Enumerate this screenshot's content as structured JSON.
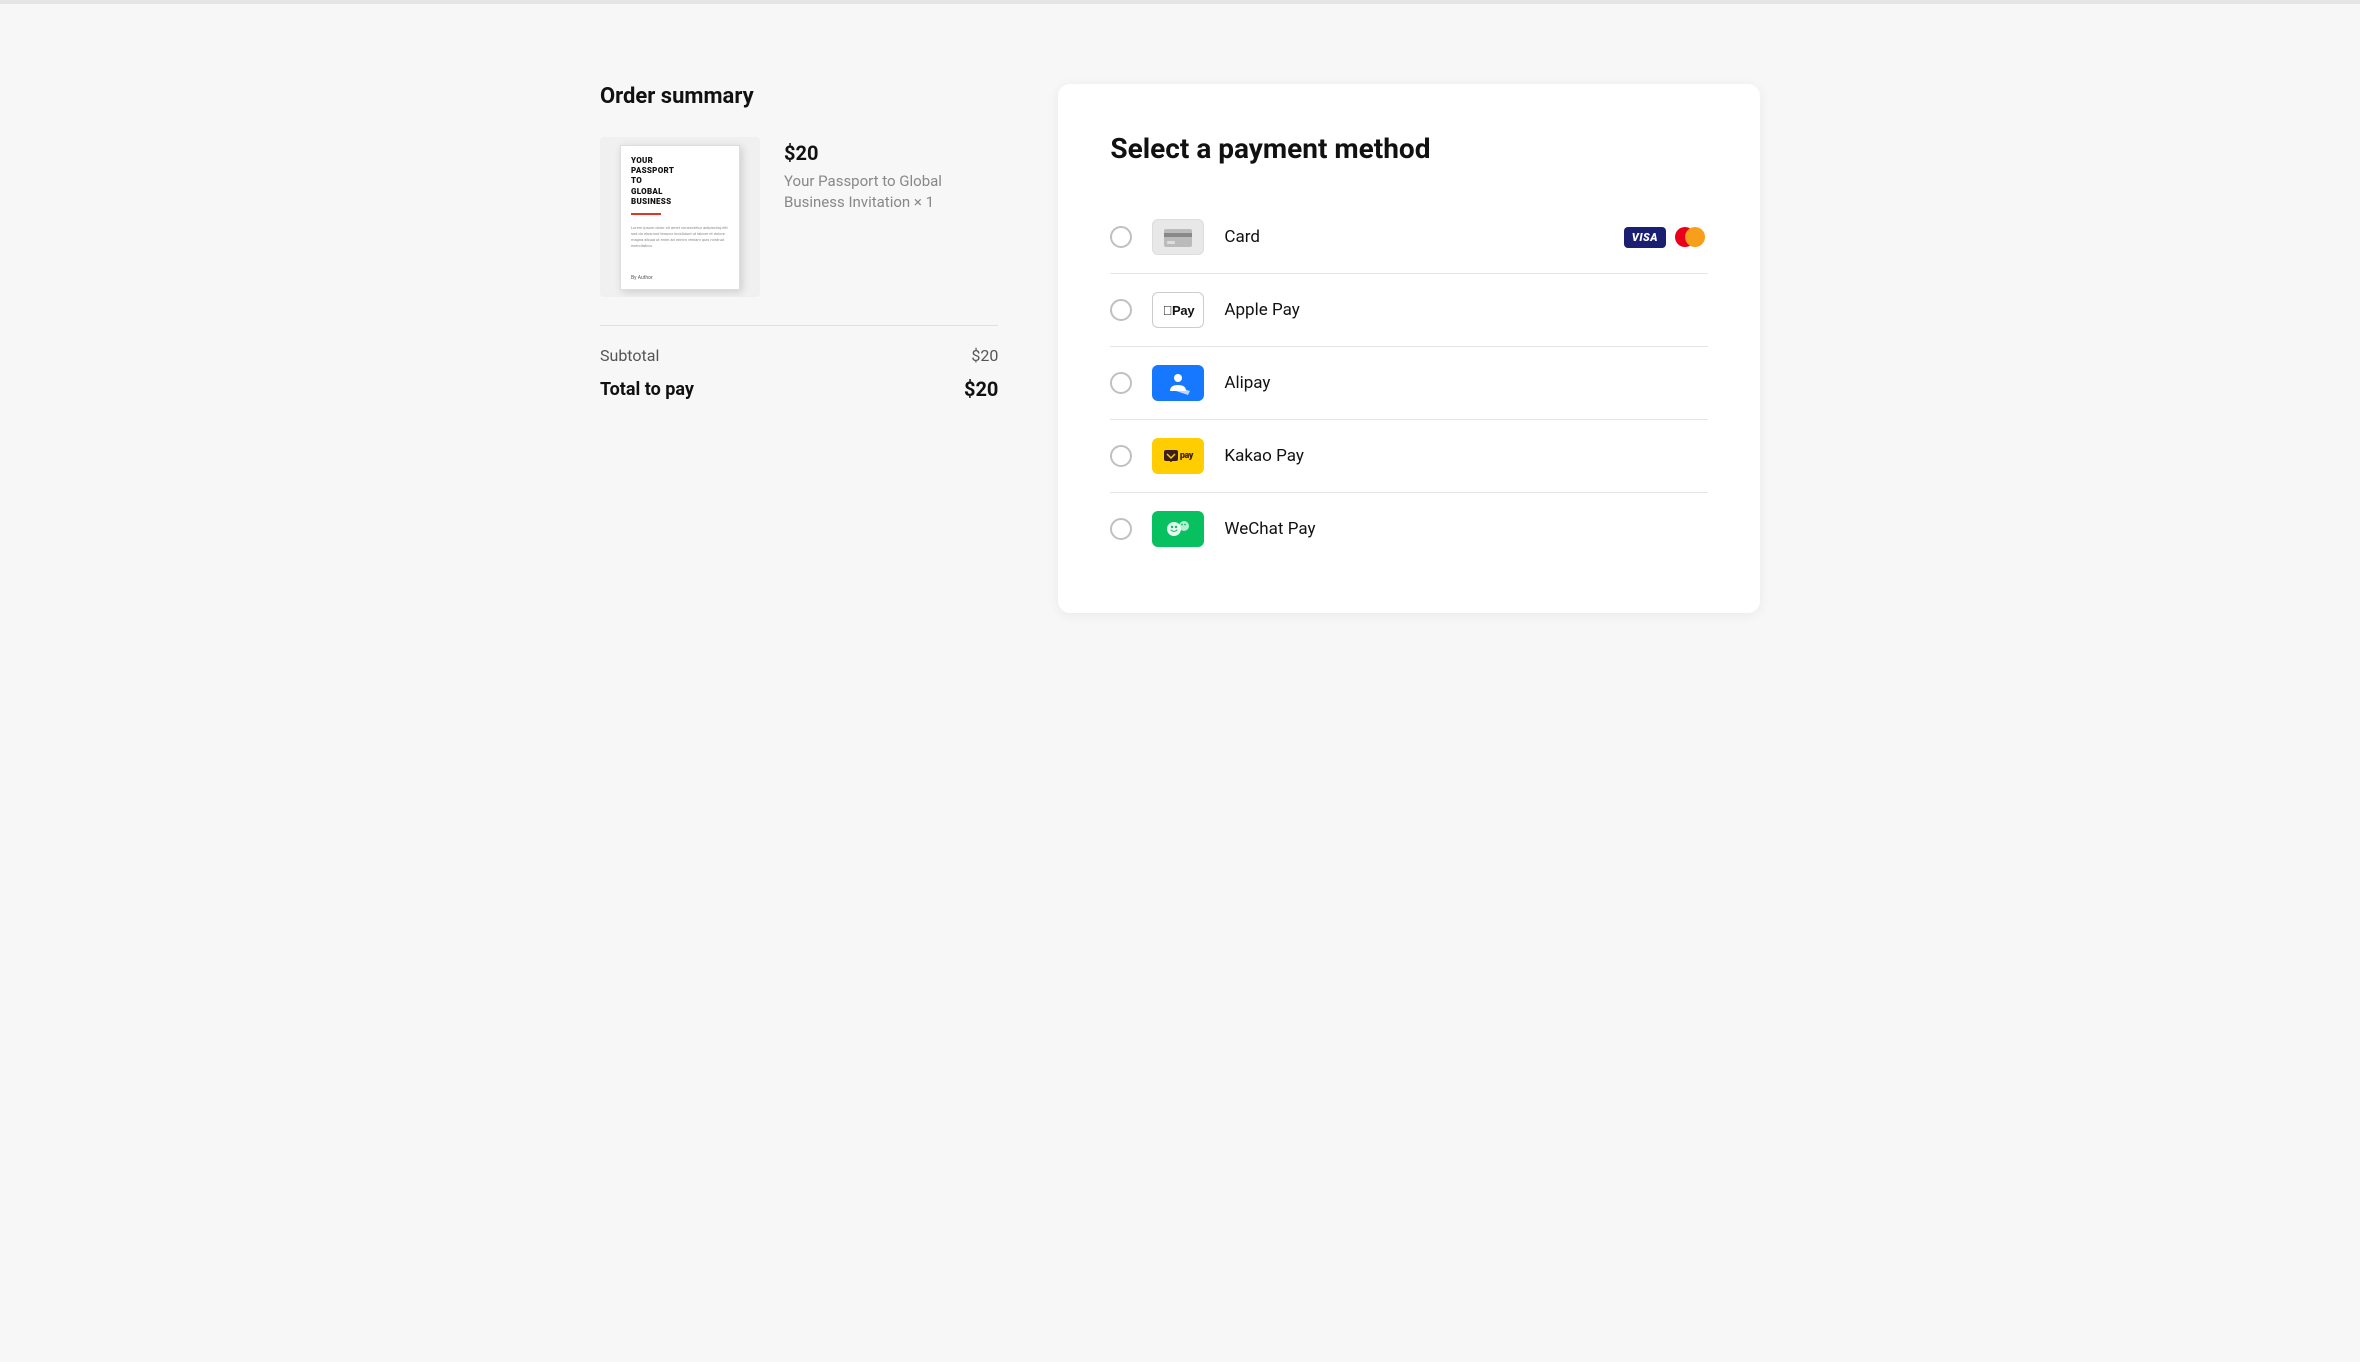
{
  "topbar": {},
  "order_summary": {
    "title": "Order summary",
    "product": {
      "price": "$20",
      "name": "Your Passport to Global Business Invitation × 1",
      "book_title_line1": "YOUR",
      "book_title_line2": "PASSPORT",
      "book_title_line3": "TO",
      "book_title_line4": "GLOBAL",
      "book_title_line5": "BUSINESS"
    },
    "subtotal_label": "Subtotal",
    "subtotal_value": "$20",
    "total_label": "Total to pay",
    "total_value": "$20"
  },
  "payment": {
    "title": "Select a payment method",
    "methods": [
      {
        "id": "card",
        "label": "Card",
        "icon_type": "card",
        "badges": [
          "visa",
          "mastercard"
        ]
      },
      {
        "id": "applepay",
        "label": "Apple Pay",
        "icon_type": "applepay"
      },
      {
        "id": "alipay",
        "label": "Alipay",
        "icon_type": "alipay"
      },
      {
        "id": "kakaopay",
        "label": "Kakao Pay",
        "icon_type": "kakaopay"
      },
      {
        "id": "wechatpay",
        "label": "WeChat Pay",
        "icon_type": "wechatpay"
      }
    ]
  }
}
